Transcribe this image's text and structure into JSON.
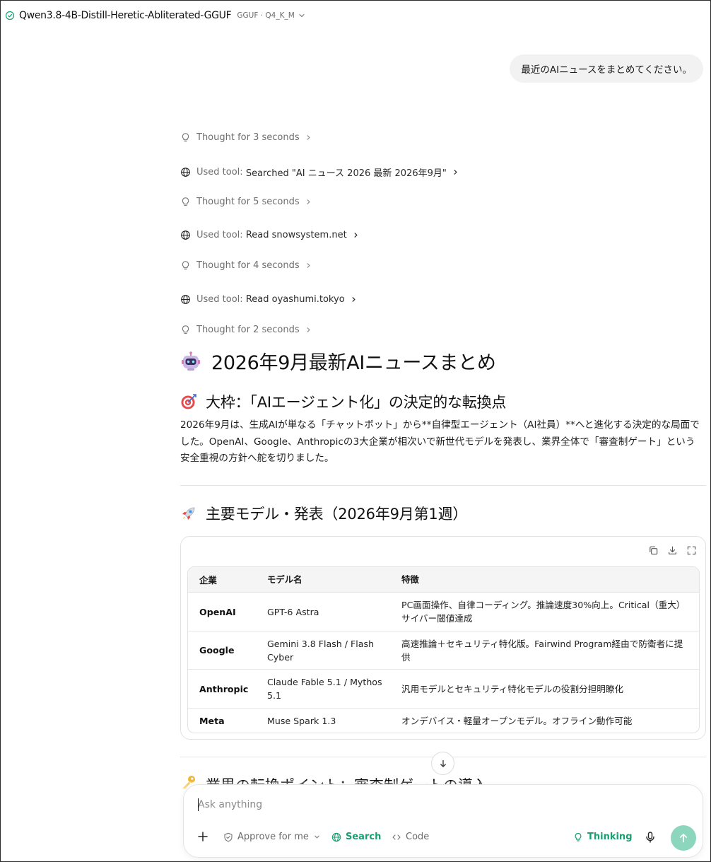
{
  "header": {
    "model_name": "Qwen3.8-4B-Distill-Heretic-Abliterated-GGUF",
    "model_meta": "GGUF · Q4_K_M"
  },
  "user_message": "最近のAIニュースをまとめてください。",
  "steps": [
    {
      "type": "thought",
      "label": "Thought for 3 seconds"
    },
    {
      "type": "tool",
      "label": "Used tool:",
      "detail": "Searched \"AI ニュース 2026 最新 2026年9月\""
    },
    {
      "type": "thought",
      "label": "Thought for 5 seconds"
    },
    {
      "type": "tool",
      "label": "Used tool:",
      "detail": "Read snowsystem.net"
    },
    {
      "type": "thought",
      "label": "Thought for 4 seconds"
    },
    {
      "type": "tool",
      "label": "Used tool:",
      "detail": "Read oyashumi.tokyo"
    },
    {
      "type": "thought",
      "label": "Thought for 2 seconds"
    }
  ],
  "answer": {
    "title": "2026年9月最新AIニュースまとめ",
    "section1_title": "大枠：「AIエージェント化」の決定的な転換点",
    "section1_body": "2026年9月は、生成AIが単なる「チャットボット」から**自律型エージェント（AI社員）**へと進化する決定的な局面でした。OpenAI、Google、Anthropicの3大企業が相次いで新世代モデルを発表し、業界全体で「審査制ゲート」という安全重視の方針へ舵を切りました。",
    "section2_title": "主要モデル・発表（2026年9月第1週）",
    "table": {
      "headers": [
        "企業",
        "モデル名",
        "特徴"
      ],
      "rows": [
        [
          "OpenAI",
          "GPT-6 Astra",
          "PC画面操作、自律コーディング。推論速度30%向上。Critical（重大）サイバー閾値達成"
        ],
        [
          "Google",
          "Gemini 3.8 Flash / Flash Cyber",
          "高速推論＋セキュリティ特化版。Fairwind Program経由で防衛者に提供"
        ],
        [
          "Anthropic",
          "Claude Fable 5.1 / Mythos 5.1",
          "汎用モデルとセキュリティ特化モデルの役割分担明瞭化"
        ],
        [
          "Meta",
          "Muse Spark 1.3",
          "オンデバイス・軽量オープンモデル。オフライン動作可能"
        ]
      ]
    },
    "section3_title": "業界の転換ポイント：審査制ゲートの導入"
  },
  "composer": {
    "placeholder": "Ask anything",
    "approve_label": "Approve for me",
    "search_label": "Search",
    "code_label": "Code",
    "thinking_label": "Thinking"
  },
  "colors": {
    "accent": "#1a9e74",
    "send_button": "#8bd6bd",
    "user_bubble": "#f2f2f2"
  }
}
